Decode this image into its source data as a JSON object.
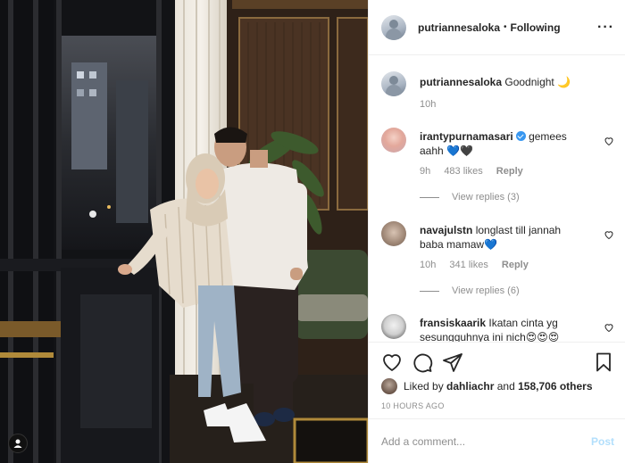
{
  "post": {
    "username": "putriannesaloka",
    "dot": "•",
    "follow_state": "Following",
    "more": "···",
    "caption": {
      "username": "putriannesaloka",
      "text": "Goodnight 🌙",
      "time": "10h"
    },
    "comments": [
      {
        "username": "irantypurnamasari",
        "verified": true,
        "text_line1": "gemees",
        "text_line2": "aahh 💙🖤",
        "time": "9h",
        "likes": "483 likes",
        "reply": "Reply",
        "view_replies": "View replies (3)"
      },
      {
        "username": "navajulstn",
        "verified": false,
        "text_line1": "longlast till jannah",
        "text_line2": "baba mamaw💙",
        "time": "10h",
        "likes": "341 likes",
        "reply": "Reply",
        "view_replies": "View replies (6)"
      },
      {
        "username": "fransiskaarik",
        "verified": false,
        "text_line1": "Ikatan cinta yg",
        "text_line2": "sesungguhnya ini nich😍😍😍"
      }
    ],
    "liked_by": {
      "prefix": "Liked by",
      "user": "dahliachr",
      "and": "and",
      "others": "158,706 others"
    },
    "time_ago": "10 HOURS AGO",
    "add_comment_placeholder": "Add a comment...",
    "post_button": "Post"
  },
  "icons": {
    "like": "heart-icon",
    "comment": "comment-icon",
    "share": "paper-plane-icon",
    "save": "bookmark-icon",
    "tag": "user-tag-icon",
    "comment_like": "heart-icon"
  },
  "colors": {
    "text": "#262626",
    "secondary": "#8e8e8e",
    "border": "#efefef",
    "verified": "#3897f0",
    "post_disabled": "#b2dffc"
  }
}
